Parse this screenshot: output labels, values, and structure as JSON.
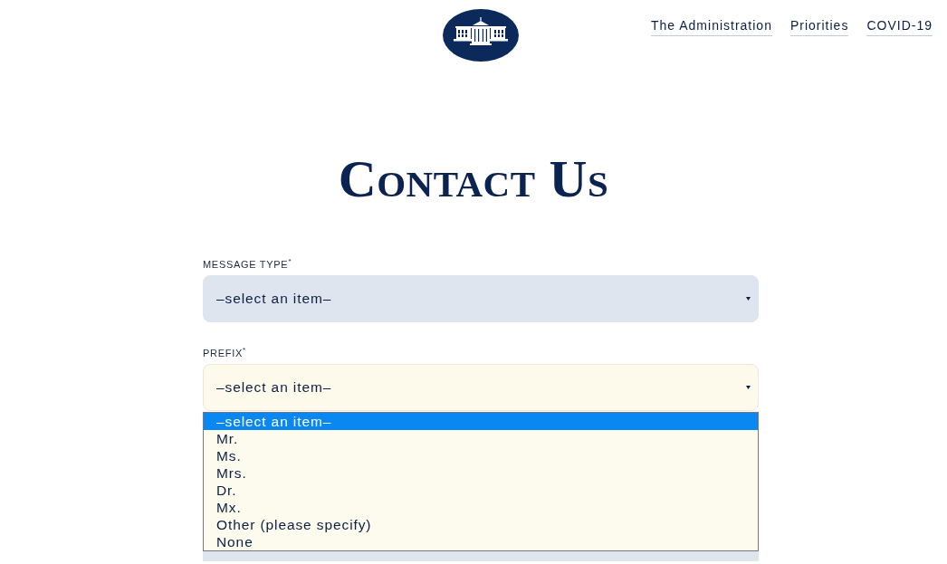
{
  "header": {
    "nav_links": [
      "The Administration",
      "Priorities",
      "COVID-19"
    ]
  },
  "page_title": "Contact Us",
  "form": {
    "fields": [
      {
        "kind": "select",
        "label": "MESSAGE TYPE$^{*}$",
        "value": "–select an item–",
        "focused": false
      },
      {
        "kind": "select",
        "label": "PREFIX$^{*}$",
        "value": "–select an item–",
        "focused": true,
        "open": true,
        "options": [
          {
            "label": "–select an item–",
            "selected": true
          },
          {
            "label": "Mr.",
            "selected": false
          },
          {
            "label": "Ms.",
            "selected": false
          },
          {
            "label": "Mrs.",
            "selected": false
          },
          {
            "label": "Dr.",
            "selected": false
          },
          {
            "label": "Mx.",
            "selected": false
          },
          {
            "label": "Other (please specify)",
            "selected": false
          },
          {
            "label": "None",
            "selected": false
          }
        ]
      },
      {
        "kind": "text",
        "focused": false
      }
    ]
  }
}
